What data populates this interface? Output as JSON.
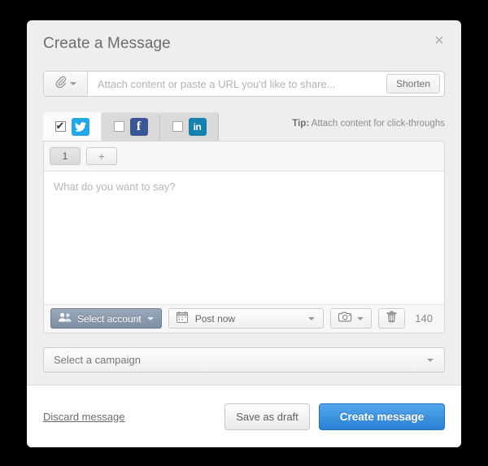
{
  "modal": {
    "title": "Create a Message",
    "close_icon": "close-icon"
  },
  "attach": {
    "clip_icon": "paperclip-icon",
    "url_placeholder": "Attach content or paste a URL you'd like to share...",
    "url_value": "",
    "shorten_label": "Shorten"
  },
  "networks": {
    "tip_label": "Tip:",
    "tip_text": "Attach content for click-throughs",
    "tabs": [
      {
        "name": "twitter",
        "glyph": "",
        "checked": true,
        "active": true,
        "color": "#22a7e8"
      },
      {
        "name": "facebook",
        "glyph": "f",
        "checked": false,
        "active": false,
        "color": "#3a5795"
      },
      {
        "name": "linkedin",
        "glyph": "in",
        "checked": false,
        "active": false,
        "color": "#1383ad"
      }
    ]
  },
  "composer": {
    "message_tabs": [
      {
        "label": "1",
        "selected": true
      },
      {
        "label": "+",
        "selected": false
      }
    ],
    "textarea_placeholder": "What do you want to say?",
    "textarea_value": "",
    "toolbar": {
      "account_label": "Select account",
      "account_icon": "users-icon",
      "schedule_label": "Post now",
      "schedule_icon": "calendar-icon",
      "photo_icon": "camera-icon",
      "delete_icon": "trash-icon",
      "char_count": "140"
    }
  },
  "campaign": {
    "placeholder": "Select a campaign"
  },
  "footer": {
    "discard_label": "Discard message",
    "draft_label": "Save as draft",
    "create_label": "Create message"
  },
  "colors": {
    "primary": "#2a7fd4",
    "twitter": "#22a7e8",
    "facebook": "#3a5795",
    "linkedin": "#1383ad",
    "account_button": "#7e8fa5"
  }
}
